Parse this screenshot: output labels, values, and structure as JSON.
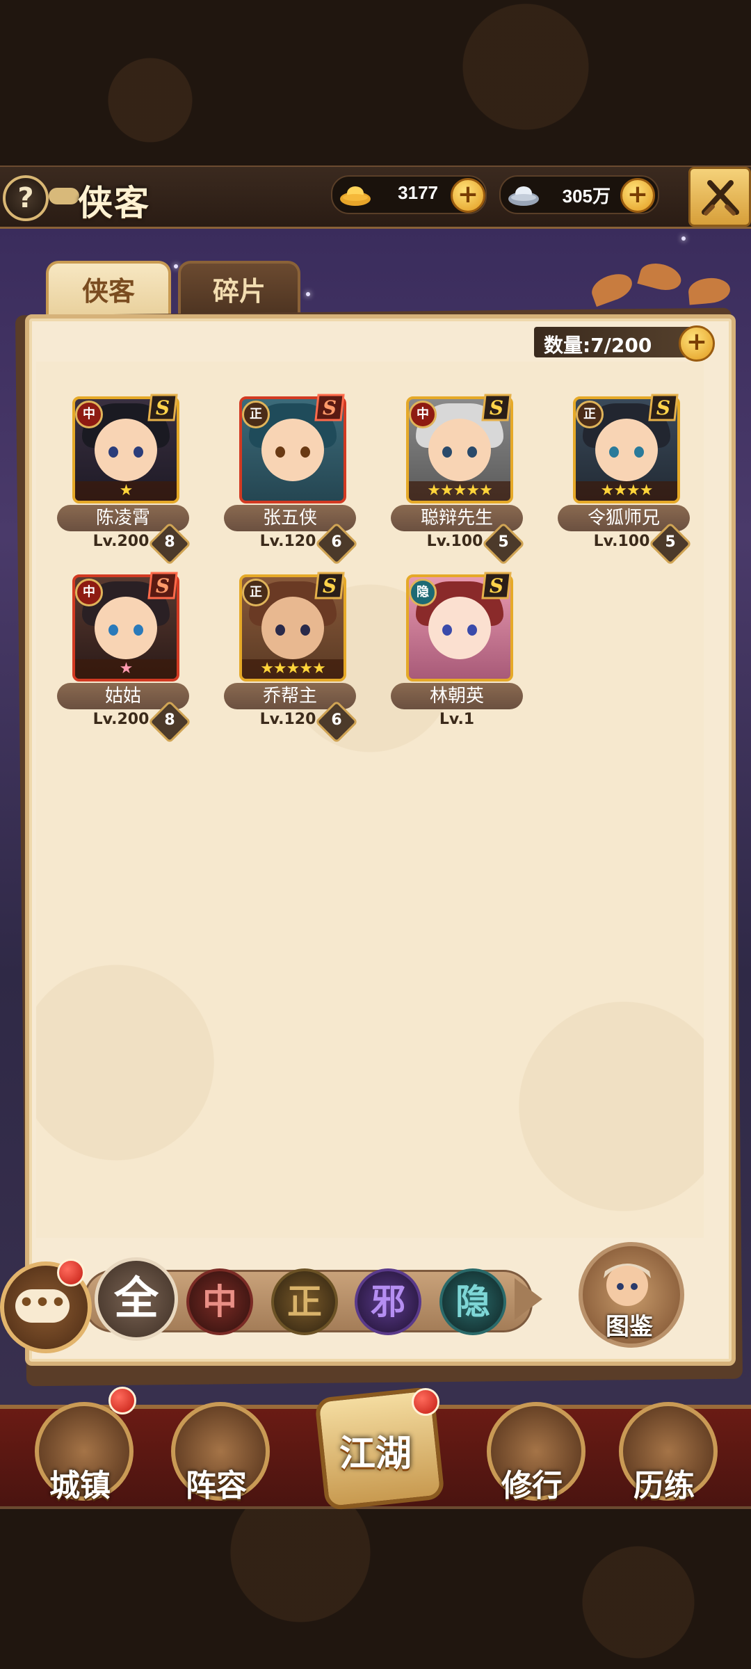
{
  "header": {
    "title": "侠客",
    "help_label": "?",
    "currency_gold": {
      "value": "3177",
      "icon": "gold-ingot-icon"
    },
    "currency_silver": {
      "value": "305万",
      "icon": "silver-ingot-icon"
    },
    "close_icon": "crossed-swords-icon"
  },
  "tabs": [
    {
      "label": "侠客",
      "active": true
    },
    {
      "label": "碎片",
      "active": false
    }
  ],
  "roster": {
    "count_label": "数量:7/200",
    "heroes": [
      {
        "name": "陈凌霄",
        "level": "Lv.200",
        "faction": "中",
        "stars": "★",
        "star_color": "gold",
        "rank": "S",
        "awaken": "8"
      },
      {
        "name": "张五侠",
        "level": "Lv.120",
        "faction": "正",
        "stars": "",
        "star_color": "gold",
        "rank": "S",
        "awaken": "6"
      },
      {
        "name": "聪辩先生",
        "level": "Lv.100",
        "faction": "中",
        "stars": "★★★★★",
        "star_color": "gold",
        "rank": "S",
        "awaken": "5"
      },
      {
        "name": "令狐师兄",
        "level": "Lv.100",
        "faction": "正",
        "stars": "★★★★",
        "star_color": "gold",
        "rank": "S",
        "awaken": "5"
      },
      {
        "name": "姑姑",
        "level": "Lv.200",
        "faction": "中",
        "stars": "★",
        "star_color": "pink",
        "rank": "S",
        "awaken": "8"
      },
      {
        "name": "乔帮主",
        "level": "Lv.120",
        "faction": "正",
        "stars": "★★★★★",
        "star_color": "gold",
        "rank": "S",
        "awaken": "6"
      },
      {
        "name": "林朝英",
        "level": "Lv.1",
        "faction": "隐",
        "stars": "",
        "star_color": "gold",
        "rank": "S",
        "awaken": ""
      }
    ]
  },
  "filters": [
    {
      "label": "全",
      "selected": true
    },
    {
      "label": "中",
      "selected": false
    },
    {
      "label": "正",
      "selected": false
    },
    {
      "label": "邪",
      "selected": false
    },
    {
      "label": "隐",
      "selected": false
    }
  ],
  "codex": {
    "label": "图鉴"
  },
  "chat": {
    "icon": "chat-bubble-icon",
    "glyph": "•••"
  },
  "bottom_nav": [
    {
      "label": "城镇",
      "icon": "town-icon",
      "notify": true
    },
    {
      "label": "阵容",
      "icon": "lineup-icon",
      "notify": false
    },
    {
      "label": "江湖",
      "icon": "jianghu-scroll-icon",
      "notify": true
    },
    {
      "label": "修行",
      "icon": "cultivation-icon",
      "notify": false
    },
    {
      "label": "历练",
      "icon": "training-icon",
      "notify": false
    }
  ]
}
